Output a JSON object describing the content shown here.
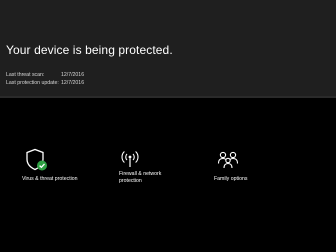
{
  "header": {
    "title": "Your device is being protected.",
    "last_threat_scan_label": "Last threat scan:",
    "last_threat_scan_value": "12/7/2016",
    "last_protection_update_label": "Last protection update:",
    "last_protection_update_value": "12/7/2016"
  },
  "tiles": [
    {
      "label": "Virus & threat protection",
      "icon": "shield-check-icon"
    },
    {
      "label": "Firewall & network protection",
      "icon": "antenna-icon"
    },
    {
      "label": "Family options",
      "icon": "family-icon"
    }
  ],
  "colors": {
    "header_bg": "#1f1f1f",
    "page_bg": "#000000",
    "status_ok": "#2ea043"
  }
}
